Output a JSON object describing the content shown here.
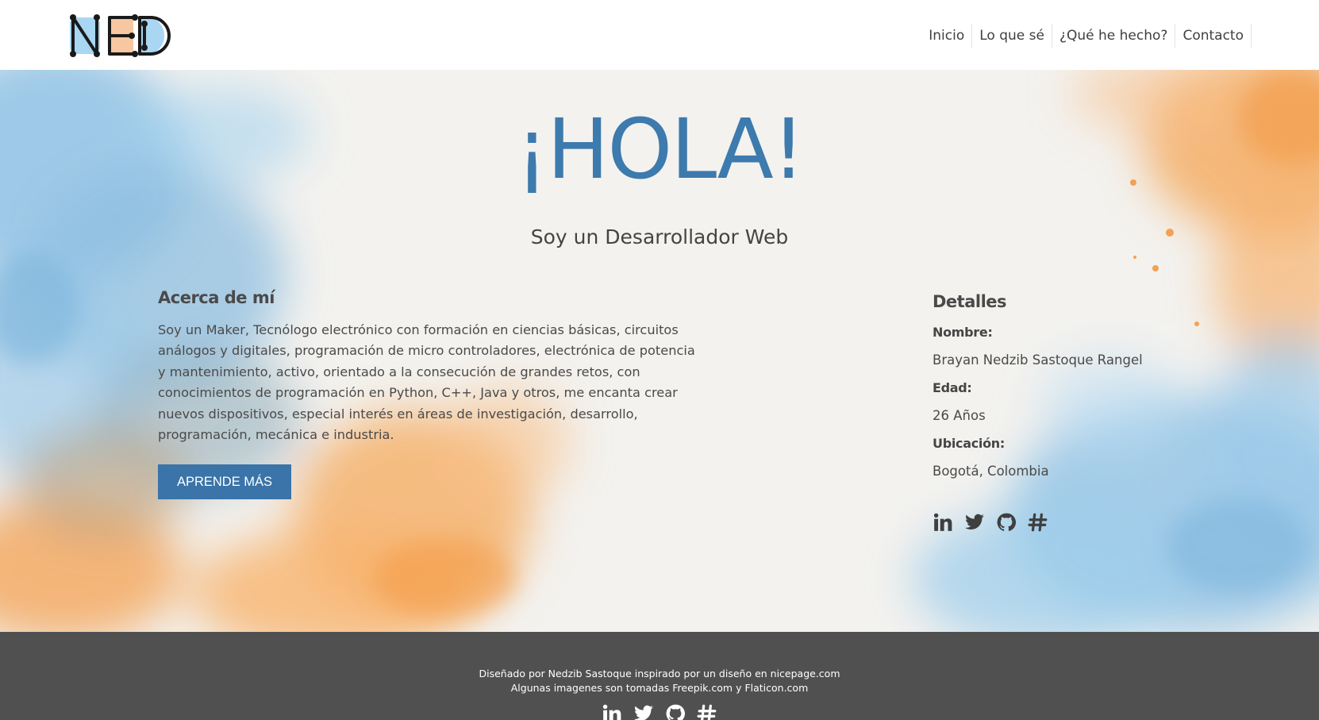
{
  "header": {
    "logo_alt": "NED",
    "nav": [
      {
        "label": "Inicio"
      },
      {
        "label": "Lo que sé"
      },
      {
        "label": "¿Qué he hecho?"
      },
      {
        "label": "Contacto"
      }
    ]
  },
  "hero": {
    "greeting": "¡HOLA!",
    "subtitle": "Soy un Desarrollador Web"
  },
  "about": {
    "title": "Acerca de mí",
    "text": "Soy un Maker, Tecnólogo electrónico con formación en ciencias básicas, circuitos análogos y digitales, programación de micro controladores, electrónica de potencia y mantenimiento, activo, orientado a la consecución de grandes retos, con conocimientos de programación en Python, C++, Java y otros, me encanta crear nuevos dispositivos, especial interés en áreas de investigación, desarrollo, programación, mecánica e industria.",
    "button_label": "APRENDE MÁS"
  },
  "details": {
    "title": "Detalles",
    "name_label": "Nombre:",
    "name_value": "Brayan Nedzib Sastoque Rangel",
    "age_label": "Edad:",
    "age_value": "26 Años",
    "location_label": "Ubicación:",
    "location_value": "Bogotá, Colombia",
    "social_icons": [
      "linkedin-icon",
      "twitter-icon",
      "github-icon",
      "hashnode-icon"
    ]
  },
  "footer": {
    "line1": "Diseñado por Nedzib Sastoque inspirado por un diseño en nicepage.com",
    "line2": "Algunas imagenes son tomadas Freepik.com y Flaticon.com"
  },
  "colors": {
    "accent": "#3d7aad",
    "button": "#3a74a8",
    "footer_bg": "#505050",
    "watercolor_blue": "#8ec2e6",
    "watercolor_orange": "#f5a95c"
  }
}
